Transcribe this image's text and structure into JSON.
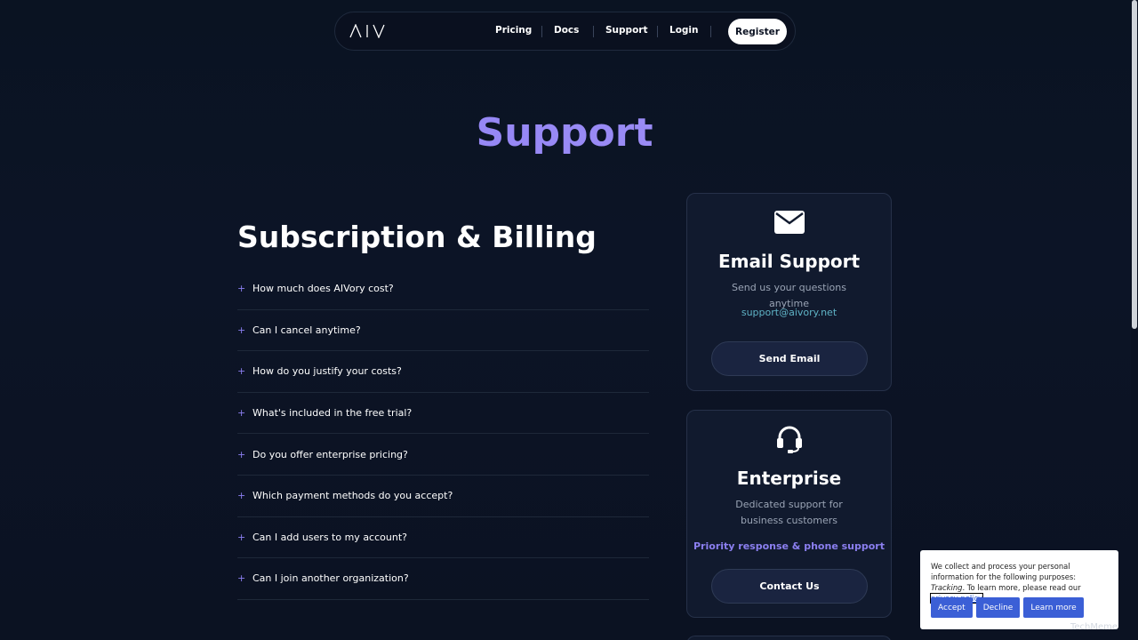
{
  "nav": {
    "brand": "AIV",
    "links": [
      "Pricing",
      "Docs",
      "Support",
      "Login"
    ],
    "register_label": "Register"
  },
  "page": {
    "title": "Support"
  },
  "faq": {
    "title": "Subscription & Billing",
    "expand_symbol": "+",
    "questions": [
      "How much does AIVory cost?",
      "Can I cancel anytime?",
      "How do you justify your costs?",
      "What's included in the free trial?",
      "Do you offer enterprise pricing?",
      "Which payment methods do you accept?",
      "Can I add users to my account?",
      "Can I join another organization?"
    ]
  },
  "email_card": {
    "icon": "envelope-icon",
    "title": "Email Support",
    "description": "Send us your questions anytime",
    "email": "support@aivory.net",
    "button_label": "Send Email"
  },
  "enterprise_card": {
    "icon": "headset-icon",
    "title": "Enterprise",
    "description": "Dedicated support for business customers",
    "highlight": "Priority response & phone support",
    "button_label": "Contact Us"
  },
  "cookie": {
    "text_before": "We collect and process your personal information for the following purposes: ",
    "purpose": "Tracking",
    "text_after": ". To learn more, please read our ",
    "policy_link": "privacy policy",
    "accept_label": "Accept",
    "decline_label": "Decline",
    "learn_more_label": "Learn more"
  },
  "watermark": "TechMeme",
  "colors": {
    "accent": "#8b7ff0",
    "link_teal": "#5fb3c6",
    "background": "#0b1222",
    "card": "#111a2e"
  }
}
